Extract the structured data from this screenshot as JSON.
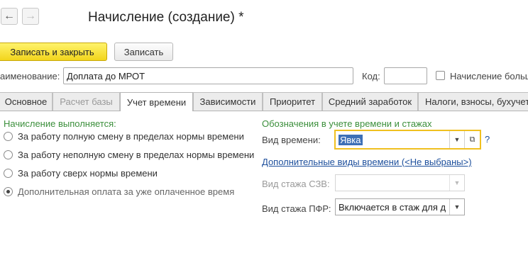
{
  "window": {
    "title": "Начисление (создание) *"
  },
  "toolbar": {
    "save_close_label": "Записать и закрыть",
    "save_label": "Записать"
  },
  "header_fields": {
    "name_label": "аименование:",
    "name_value": "Доплата до МРОТ",
    "code_label": "Код:",
    "code_value": "",
    "checkbox_label": "Начисление больш"
  },
  "tabs": [
    {
      "label": "Основное",
      "state": "normal"
    },
    {
      "label": "Расчет базы",
      "state": "disabled"
    },
    {
      "label": "Учет времени",
      "state": "active"
    },
    {
      "label": "Зависимости",
      "state": "normal"
    },
    {
      "label": "Приоритет",
      "state": "normal"
    },
    {
      "label": "Средний заработок",
      "state": "normal"
    },
    {
      "label": "Налоги, взносы, бухучет",
      "state": "normal"
    }
  ],
  "left_panel": {
    "title": "Начисление выполняется:",
    "options": [
      {
        "label": "За работу полную смену в пределах нормы времени",
        "checked": false
      },
      {
        "label": "За работу неполную смену в пределах нормы времени",
        "checked": false
      },
      {
        "label": "За работу сверх нормы времени",
        "checked": false
      },
      {
        "label": "Дополнительная оплата за уже оплаченное время",
        "checked": true
      }
    ]
  },
  "right_panel": {
    "title": "Обозначения в учете времени и стажах",
    "time_type_label": "Вид времени:",
    "time_type_value": "Явка",
    "help_label": "?",
    "extra_link": "Дополнительные виды времени (<Не выбраны>)",
    "szv_label": "Вид стажа СЗВ:",
    "szv_value": "",
    "pfr_label": "Вид стажа ПФР:",
    "pfr_value": "Включается в стаж для д"
  },
  "colors": {
    "accent_yellow": "#f2d51c",
    "section_green": "#3b8f3b",
    "link_blue": "#1d4f9c",
    "focus_border": "#f0c020"
  }
}
